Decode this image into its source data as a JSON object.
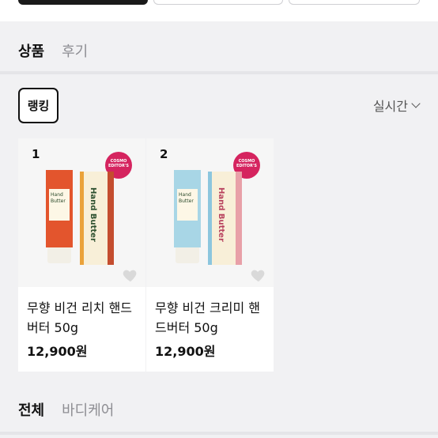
{
  "tabs": {
    "product": "상품",
    "review": "후기"
  },
  "ranking_chip": "랭킹",
  "sort": {
    "label": "실시간"
  },
  "products": [
    {
      "rank": "1",
      "name": "무향 비건 리치 핸드버터 50g",
      "price": "12,900원",
      "badge": "COSMO EDITOR'S",
      "box_text": "Hand Butter",
      "tube_text": "Hand Butter",
      "color_tube": "#e3552d",
      "color_stripe": "#c44d2f"
    },
    {
      "rank": "2",
      "name": "무향 비건 크리미 핸드버터 50g",
      "price": "12,900원",
      "badge": "COSMO EDITOR'S",
      "box_text": "Hand Butter",
      "tube_text": "Hand Butter",
      "color_tube": "#a8d6e6",
      "color_stripe": "#e8a0a8"
    }
  ],
  "category_tabs": {
    "all": "전체",
    "body": "바디케어"
  },
  "colors": {
    "accent": "#111111",
    "muted": "#8e8e93",
    "badge": "#d5245f"
  }
}
